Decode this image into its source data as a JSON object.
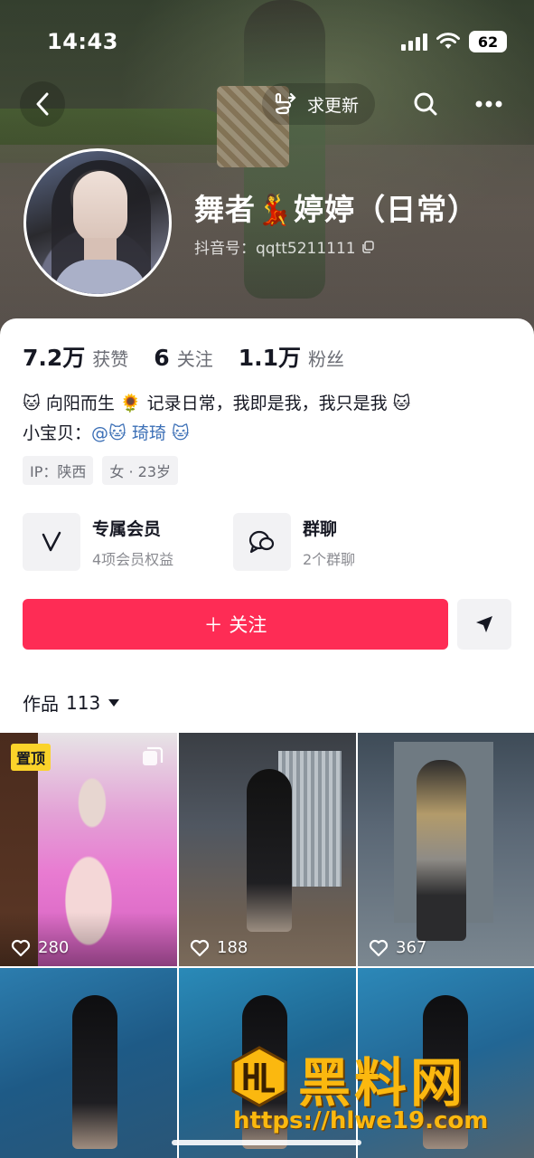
{
  "status_bar": {
    "time": "14:43",
    "battery": "62"
  },
  "nav": {
    "update_label": "求更新"
  },
  "profile": {
    "nickname": "舞者💃婷婷（日常）",
    "douyin_id": "抖音号：qqtt5211111"
  },
  "stats": [
    {
      "value": "7.2万",
      "label": "获赞"
    },
    {
      "value": "6",
      "label": "关注"
    },
    {
      "value": "1.1万",
      "label": "粉丝"
    }
  ],
  "bio": {
    "line1": "🐱 向阳而生 🌻 记录日常，我即是我，我只是我 🐱",
    "line2_prefix": "小宝贝：",
    "line2_mention": "@🐱 琦琦 🐱"
  },
  "tags": [
    "IP：陕西",
    "女 · 23岁"
  ],
  "features": [
    {
      "title": "专属会员",
      "subtitle": "4项会员权益",
      "icon": "vip-v-icon"
    },
    {
      "title": "群聊",
      "subtitle": "2个群聊",
      "icon": "chat-bubbles-icon"
    }
  ],
  "follow_label": "＋ 关注",
  "works": {
    "label": "作品",
    "count": "113"
  },
  "grid": [
    {
      "likes": "280",
      "pinned": "置顶"
    },
    {
      "likes": "188"
    },
    {
      "likes": "367"
    },
    {},
    {},
    {}
  ],
  "watermark": {
    "title": "黑料网",
    "url": "https://hlwe19.com"
  },
  "colors": {
    "accent": "#fe2c55",
    "mention": "#3b6fb6",
    "pin_badge": "#fbd32a"
  }
}
